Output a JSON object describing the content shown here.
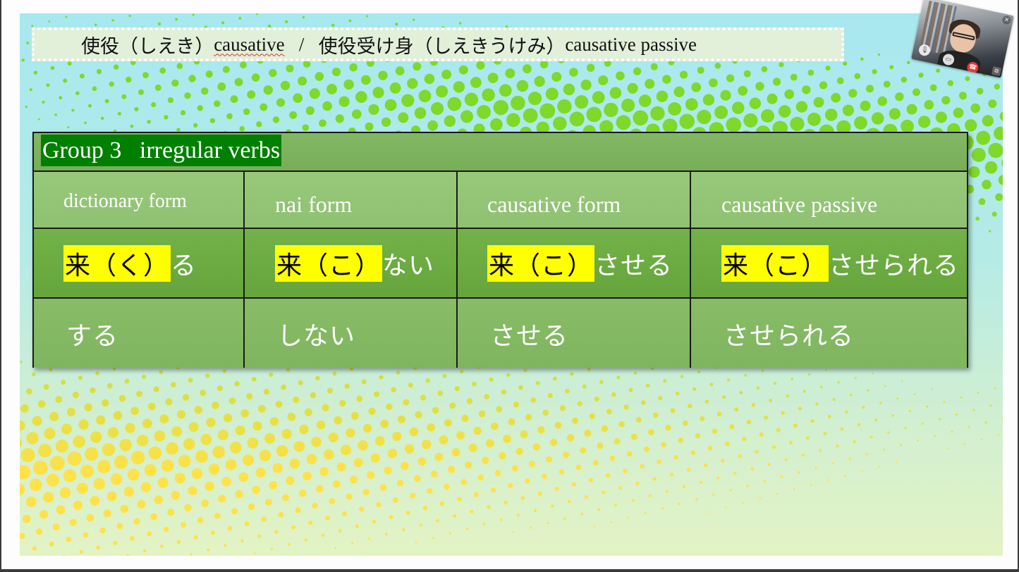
{
  "slide": {
    "title": {
      "part1_jp": "使役（しえき）",
      "part1_en": "causative",
      "separator": "   /   ",
      "part2_jp": "使役受け身（しえきうけみ）",
      "part2_en": "causative passive"
    },
    "table": {
      "group_label": "Group 3   irregular verbs",
      "headers": [
        "dictionary form",
        "nai form",
        "causative form",
        "causative passive"
      ],
      "rows": [
        [
          {
            "highlight": "来（く）",
            "rest": "る"
          },
          {
            "highlight": "来（こ）",
            "rest": "ない"
          },
          {
            "highlight": "来（こ）",
            "rest": "させる"
          },
          {
            "highlight": "来（こ）",
            "rest": "させられる"
          }
        ],
        [
          {
            "text": "する"
          },
          {
            "text": "しない"
          },
          {
            "text": "させる"
          },
          {
            "text": "させられる"
          }
        ]
      ]
    }
  },
  "video_call": {
    "close_icon": "×",
    "mic_icon": "🎙",
    "camera_icon": "▭",
    "hangup_icon": "☎",
    "popout_icon": "⧉"
  },
  "colors": {
    "title_bg": "#e2efd9",
    "group_label_bg": "#007f00",
    "header_row": "#93c476",
    "row1": "#6cab42",
    "row2": "#84b963",
    "highlight": "#ffff00",
    "dots_top": "#7fd82a",
    "dots_bottom": "#ffe14a"
  }
}
